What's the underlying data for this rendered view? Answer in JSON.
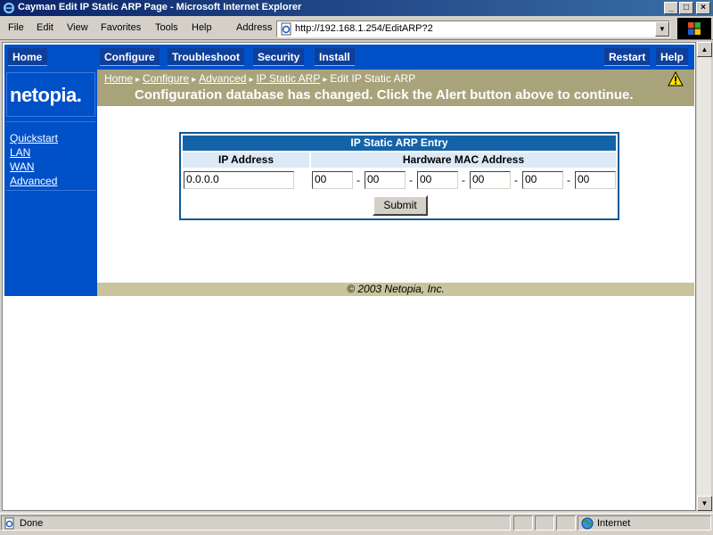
{
  "window": {
    "title": "Cayman Edit IP Static ARP Page - Microsoft Internet Explorer"
  },
  "menu": [
    "File",
    "Edit",
    "View",
    "Favorites",
    "Tools",
    "Help"
  ],
  "address": {
    "label": "Address",
    "url": "http://192.168.1.254/EditARP?2"
  },
  "nav": {
    "home": "Home",
    "configure": "Configure",
    "troubleshoot": "Troubleshoot",
    "security": "Security",
    "install": "Install",
    "restart": "Restart",
    "help": "Help"
  },
  "logo": "netopia.",
  "sidebar": [
    "Quickstart",
    "LAN",
    "WAN",
    "Advanced"
  ],
  "breadcrumb": {
    "links": [
      "Home",
      "Configure",
      "Advanced",
      "IP Static ARP"
    ],
    "current": "Edit IP Static ARP",
    "sep": "▸"
  },
  "alert_message": "Configuration database has changed. Click the Alert button above to continue.",
  "form": {
    "title": "IP Static ARP Entry",
    "col_ip": "IP Address",
    "col_mac": "Hardware MAC Address",
    "ip_value": "0.0.0.0",
    "mac": [
      "00",
      "00",
      "00",
      "00",
      "00",
      "00"
    ],
    "dash": "-",
    "submit": "Submit"
  },
  "footer": "© 2003 Netopia, Inc.",
  "status": {
    "text": "Done",
    "zone": "Internet"
  },
  "colors": {
    "nav_blue": "#0050c8",
    "alert_bar": "#a9a37c",
    "footer_bar": "#c9c49c",
    "table_blue": "#1463a8"
  }
}
